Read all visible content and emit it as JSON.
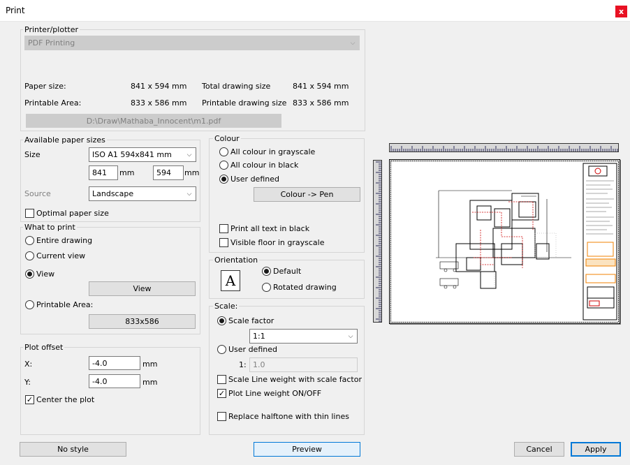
{
  "window": {
    "title": "Print",
    "close": "x"
  },
  "printer": {
    "group_label": "Printer/plotter",
    "device": "PDF Printing",
    "paper_size_label": "Paper size:",
    "paper_size_value": "841 x 594 mm",
    "total_drawing_label": "Total drawing size",
    "total_drawing_value": "841 x 594 mm",
    "printable_area_label": "Printable Area:",
    "printable_area_value": "833 x 586 mm",
    "printable_drawing_label": "Printable drawing size",
    "printable_drawing_value": "833 x 586 mm",
    "path": "D:\\Draw\\Mathaba_Innocent\\m1.pdf"
  },
  "paper": {
    "group_label": "Available paper sizes",
    "size_label": "Size",
    "size_value": "ISO A1 594x841 mm",
    "width": "841",
    "height": "594",
    "unit": "mm",
    "source_label": "Source",
    "source_value": "Landscape",
    "optimal_label": "Optimal paper size"
  },
  "what_to_print": {
    "group_label": "What to print",
    "entire": "Entire drawing",
    "current": "Current view",
    "view": "View",
    "view_button": "View",
    "printable": "Printable Area:",
    "printable_button": "833x586"
  },
  "offset": {
    "group_label": "Plot offset",
    "x_label": "X:",
    "x_value": "-4.0",
    "y_label": "Y:",
    "y_value": "-4.0",
    "unit": "mm",
    "center_label": "Center the plot"
  },
  "colour": {
    "group_label": "Colour",
    "grayscale": "All colour in grayscale",
    "black": "All colour in black",
    "user": "User defined",
    "pen_button": "Colour -> Pen",
    "text_black": "Print all text in black",
    "floor_gray": "Visible floor in grayscale"
  },
  "orientation": {
    "group_label": "Orientation",
    "icon_letter": "A",
    "default": "Default",
    "rotated": "Rotated drawing"
  },
  "scale": {
    "group_label": "Scale:",
    "factor_label": "Scale factor",
    "factor_value": "1:1",
    "user_label": "User defined",
    "user_prefix": "1:",
    "user_value": "1.0",
    "line_weight_scale": "Scale Line weight with scale factor",
    "plot_line_weight": "Plot Line weight ON/OFF",
    "halftone": "Replace halftone with thin lines"
  },
  "buttons": {
    "no_style": "No style",
    "preview": "Preview",
    "cancel": "Cancel",
    "apply": "Apply"
  },
  "state": {
    "what_to_print": "view",
    "colour_mode": "user",
    "orientation": "default",
    "scale_mode": "factor",
    "optimal_paper": false,
    "center_plot": true,
    "text_black": false,
    "floor_gray": false,
    "line_weight_scale": false,
    "plot_line_weight": true,
    "halftone": false
  },
  "colors": {
    "accent": "#0078d7",
    "close": "#e81123",
    "preview_red": "#cc0000",
    "preview_orange": "#f08000"
  }
}
